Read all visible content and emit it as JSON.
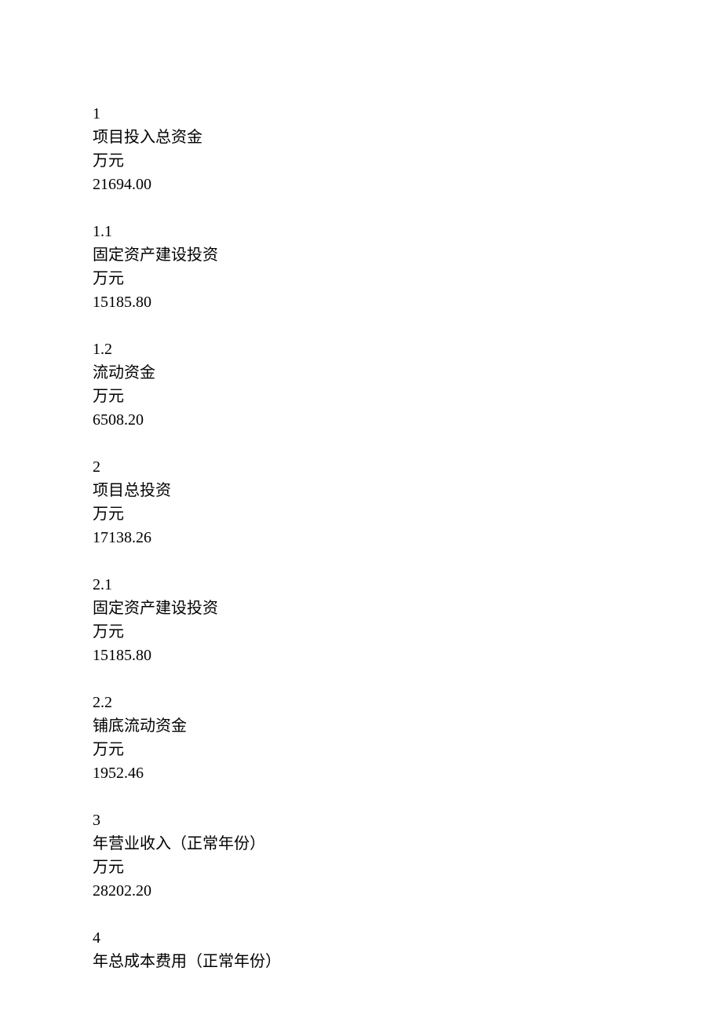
{
  "items": [
    {
      "num": "1",
      "name": "项目投入总资金",
      "unit": "万元",
      "value": "21694.00"
    },
    {
      "num": "1.1",
      "name": "固定资产建设投资",
      "unit": "万元",
      "value": "15185.80"
    },
    {
      "num": "1.2",
      "name": "流动资金",
      "unit": "万元",
      "value": "6508.20"
    },
    {
      "num": "2",
      "name": "项目总投资",
      "unit": "万元",
      "value": "17138.26"
    },
    {
      "num": "2.1",
      "name": "固定资产建设投资",
      "unit": "万元",
      "value": "15185.80"
    },
    {
      "num": "2.2",
      "name": "铺底流动资金",
      "unit": "万元",
      "value": "1952.46"
    },
    {
      "num": "3",
      "name": "年营业收入（正常年份）",
      "unit": "万元",
      "value": "28202.20"
    },
    {
      "num": "4",
      "name": "年总成本费用（正常年份）"
    }
  ]
}
